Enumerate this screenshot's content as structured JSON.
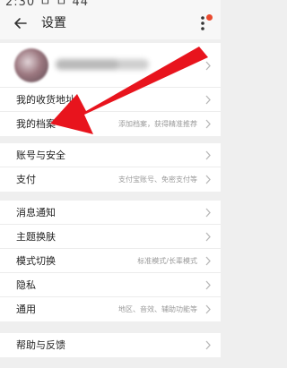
{
  "status_bar": {
    "text": "2:30 ㅁ ㅁ 44"
  },
  "header": {
    "title": "设置",
    "back_icon": "back-arrow-icon",
    "menu_icon": "more-vert-icon"
  },
  "profile": {
    "avatar_icon": "user-avatar"
  },
  "groups": [
    {
      "items": [
        {
          "label": "我的收货地址",
          "hint": ""
        },
        {
          "label": "我的档案",
          "hint": "添加档案，获得精准推荐"
        }
      ]
    },
    {
      "items": [
        {
          "label": "账号与安全",
          "hint": ""
        },
        {
          "label": "支付",
          "hint": "支付宝账号、免密支付等"
        }
      ]
    },
    {
      "items": [
        {
          "label": "消息通知",
          "hint": ""
        },
        {
          "label": "主题换肤",
          "hint": ""
        },
        {
          "label": "模式切换",
          "hint": "标准模式/长辈模式"
        },
        {
          "label": "隐私",
          "hint": ""
        },
        {
          "label": "通用",
          "hint": "地区、音效、辅助功能等"
        }
      ]
    },
    {
      "items": [
        {
          "label": "帮助与反馈",
          "hint": ""
        }
      ]
    }
  ],
  "colors": {
    "annotation_arrow": "#e8141d",
    "notification_dot": "#e94a2f",
    "background": "#efefef"
  }
}
